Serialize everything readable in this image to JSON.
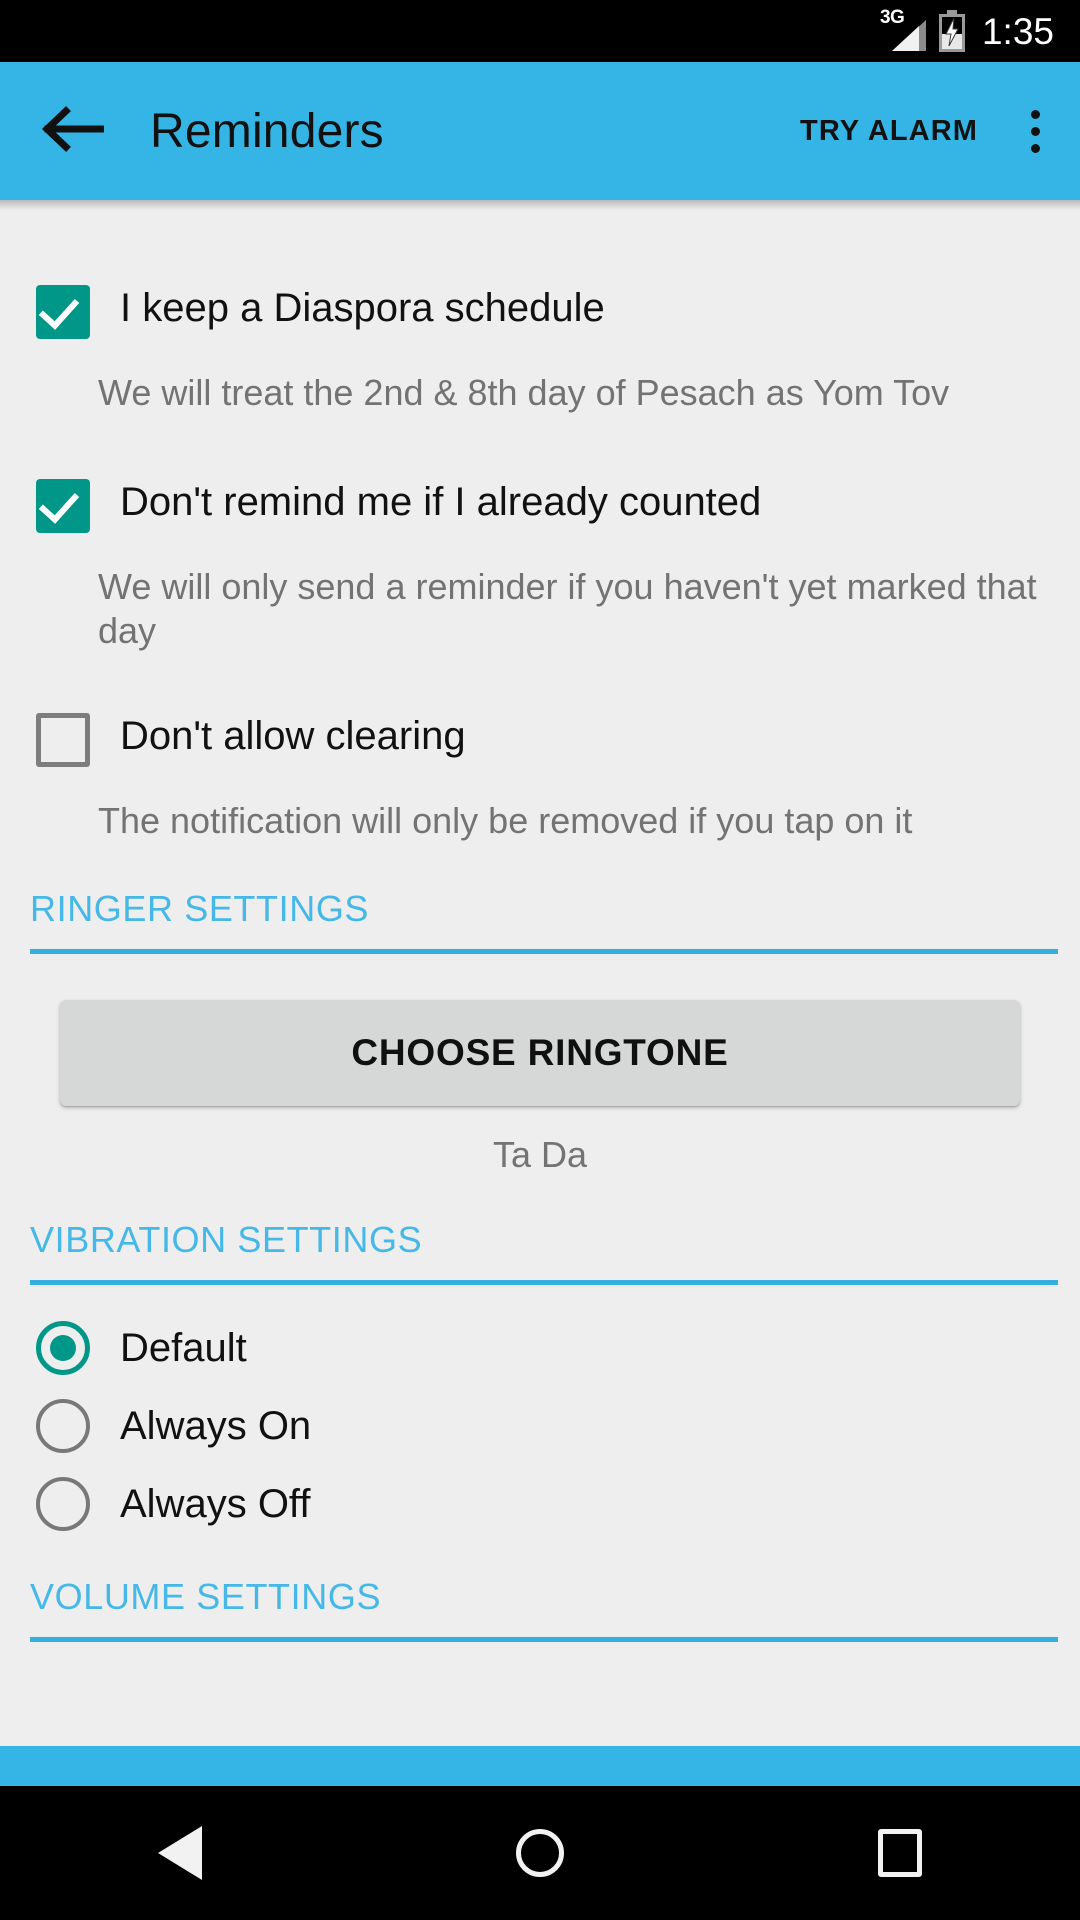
{
  "status_bar": {
    "network_label": "3G",
    "signal_icon": "signal-bars-icon",
    "battery_icon": "battery-charging-icon",
    "clock": "1:35"
  },
  "app_bar": {
    "back_icon": "arrow-back-icon",
    "title": "Reminders",
    "action_label": "TRY ALARM",
    "overflow_icon": "overflow-menu-icon",
    "background_color": "#35b5e5"
  },
  "colors": {
    "accent_blue": "#35b5e5",
    "section_header_blue": "#45b8e8",
    "control_teal": "#009688",
    "content_background": "#eeeeee"
  },
  "checkboxes": [
    {
      "label": "I keep a Diaspora schedule",
      "description": "We will treat the 2nd & 8th day of Pesach as Yom Tov",
      "checked": true
    },
    {
      "label": "Don't remind me if I already counted",
      "description": "We will only send a reminder if you haven't yet marked that day",
      "checked": true
    },
    {
      "label": "Don't allow clearing",
      "description": "The notification will only be removed if you tap on it",
      "checked": false
    }
  ],
  "ringer_section": {
    "title": "RINGER SETTINGS",
    "button_label": "CHOOSE RINGTONE",
    "selected_ringtone": "Ta Da"
  },
  "vibration_section": {
    "title": "VIBRATION SETTINGS",
    "options": [
      {
        "label": "Default",
        "selected": true
      },
      {
        "label": "Always On",
        "selected": false
      },
      {
        "label": "Always Off",
        "selected": false
      }
    ]
  },
  "volume_section": {
    "title": "VOLUME SETTINGS"
  },
  "nav_bar": {
    "back_icon": "nav-back-icon",
    "home_icon": "nav-home-icon",
    "recents_icon": "nav-recents-icon"
  }
}
